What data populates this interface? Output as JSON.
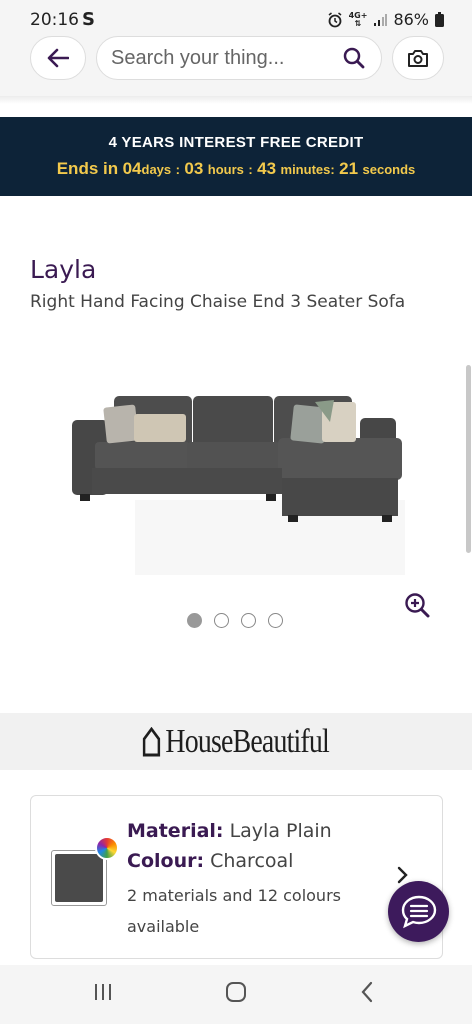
{
  "status_bar": {
    "time": "20:16",
    "carrier_icon": "S",
    "network": "4G+",
    "battery": "86%",
    "icons": [
      "alarm-icon",
      "network-4g-icon",
      "signal-icon",
      "battery-icon"
    ]
  },
  "search": {
    "placeholder": "Search your thing..."
  },
  "promo": {
    "title": "4 YEARS INTEREST FREE CREDIT",
    "ends_label": "Ends in",
    "days_value": "04",
    "days_unit": "days",
    "hours_value": "03",
    "hours_unit": "hours",
    "minutes_value": "43",
    "minutes_unit": "minutes",
    "seconds_value": "21",
    "seconds_unit": "seconds",
    "separator": ":",
    "background": "#0d2338",
    "accent": "#f2c94c"
  },
  "product": {
    "name": "Layla",
    "description": "Right Hand Facing Chaise End 3 Seater Sofa",
    "image_count": 4,
    "active_image": 1
  },
  "brand": {
    "name": "HouseBeautiful"
  },
  "material": {
    "material_label": "Material:",
    "material_value": "Layla Plain",
    "colour_label": "Colour:",
    "colour_value": "Charcoal",
    "options_note": "2 materials and 12 colours available",
    "swatch_color": "#4a4a4a"
  },
  "colors": {
    "brand_purple": "#3a1a52",
    "chat_button": "#3d1a5c"
  }
}
